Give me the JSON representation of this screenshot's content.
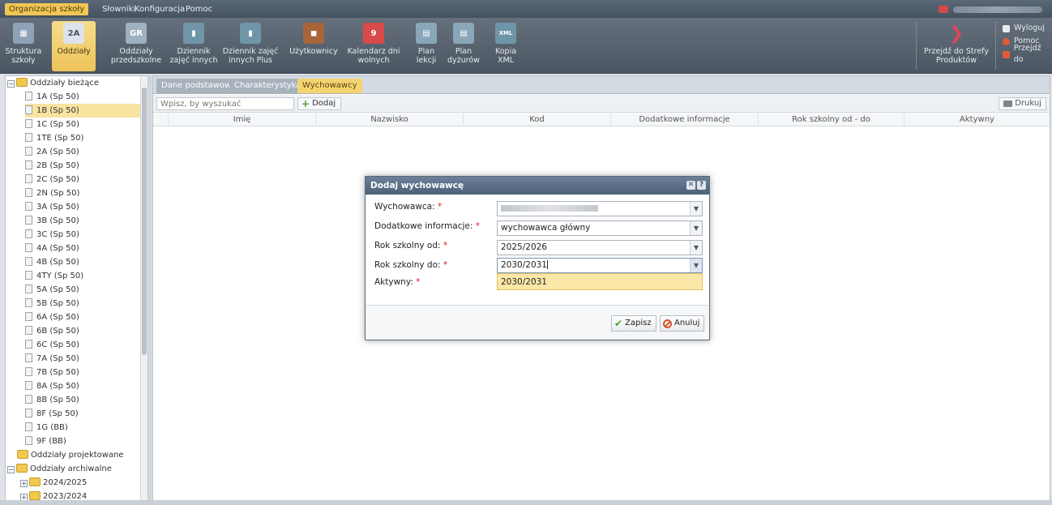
{
  "menu": {
    "items": [
      "Organizacja szkoły",
      "Słowniki",
      "Konfiguracja",
      "Pomoc"
    ],
    "active_index": 0
  },
  "toolbar": {
    "items": [
      {
        "label1": "Struktura",
        "label2": "szkoły",
        "icon": "school-structure-icon",
        "glyph": "▦",
        "color": "#8fa2b6"
      },
      {
        "label1": "Oddziały",
        "label2": "",
        "icon": "class-2a-icon",
        "glyph": "2A",
        "color": "#c9d3dc"
      },
      {
        "label1": "Oddziały",
        "label2": "przedszkolne",
        "icon": "preschool-icon",
        "glyph": "GR",
        "color": "#9fb0c0"
      },
      {
        "label1": "Dziennik",
        "label2": "zajęć innych",
        "icon": "journal-other-icon",
        "glyph": "▮",
        "color": "#6f96a8"
      },
      {
        "label1": "Dziennik zajęć",
        "label2": "innych Plus",
        "icon": "journal-plus-icon",
        "glyph": "▮",
        "color": "#6f96a8"
      },
      {
        "label1": "Użytkownicy",
        "label2": "",
        "icon": "users-briefcase-icon",
        "glyph": "◼",
        "color": "#a8643a"
      },
      {
        "label1": "Kalendarz dni",
        "label2": "wolnych",
        "icon": "calendar-icon",
        "glyph": "9",
        "color": "#d94a4a"
      },
      {
        "label1": "Plan",
        "label2": "lekcji",
        "icon": "lesson-plan-icon",
        "glyph": "▤",
        "color": "#8aa6b9"
      },
      {
        "label1": "Plan",
        "label2": "dyżurów",
        "icon": "duty-plan-icon",
        "glyph": "▤",
        "color": "#8aa6b9"
      },
      {
        "label1": "Kopia",
        "label2": "XML",
        "icon": "xml-copy-icon",
        "glyph": "XML",
        "color": "#6f96a8"
      }
    ],
    "active_index": 1,
    "products": {
      "label1": "Przejdź do Strefy",
      "label2": "Produktów"
    },
    "right_links": [
      "Wyloguj",
      "Pomoc",
      "Przejdź do"
    ]
  },
  "tree": {
    "root_label": "Oddziały bieżące",
    "items": [
      "1A (Sp 50)",
      "1B (Sp 50)",
      "1C (Sp 50)",
      "1TE (Sp 50)",
      "2A (Sp 50)",
      "2B (Sp 50)",
      "2C (Sp 50)",
      "2N (Sp 50)",
      "3A (Sp 50)",
      "3B (Sp 50)",
      "3C (Sp 50)",
      "4A (Sp 50)",
      "4B (Sp 50)",
      "4TY (Sp 50)",
      "5A (Sp 50)",
      "5B (Sp 50)",
      "6A (Sp 50)",
      "6B (Sp 50)",
      "6C (Sp 50)",
      "7A (Sp 50)",
      "7B (Sp 50)",
      "8A (Sp 50)",
      "8B (Sp 50)",
      "8F (Sp 50)",
      "1G (BB)",
      "9F (BB)"
    ],
    "selected_index": 1,
    "projected_label": "Oddziały projektowane",
    "archive_label": "Oddziały archiwalne",
    "archive_items": [
      "2024/2025",
      "2023/2024"
    ]
  },
  "tabs": [
    "Dane podstawowe",
    "Charakterystyka",
    "Wychowawcy"
  ],
  "active_tab": 2,
  "grid": {
    "search_placeholder": "Wpisz, by wyszukać",
    "add_label": "Dodaj",
    "print_label": "Drukuj",
    "columns": [
      "Imię",
      "Nazwisko",
      "Kod",
      "Dodatkowe informacje",
      "Rok szkolny od - do",
      "Aktywny"
    ]
  },
  "dialog": {
    "title": "Dodaj wychowawcę",
    "fields": {
      "teacher": {
        "label": "Wychowawca:",
        "value": ""
      },
      "info": {
        "label": "Dodatkowe informacje:",
        "value": "wychowawca główny"
      },
      "year_from": {
        "label": "Rok szkolny od:",
        "value": "2025/2026"
      },
      "year_to": {
        "label": "Rok szkolny do:",
        "value": "2030/2031"
      },
      "active": {
        "label": "Aktywny:"
      }
    },
    "required_mark": "*",
    "dropdown_option": "2030/2031",
    "save_label": "Zapisz",
    "cancel_label": "Anuluj"
  },
  "colors": {
    "accent": "#f2c655",
    "header": "#4d6179",
    "selection": "#f8e3a0"
  }
}
